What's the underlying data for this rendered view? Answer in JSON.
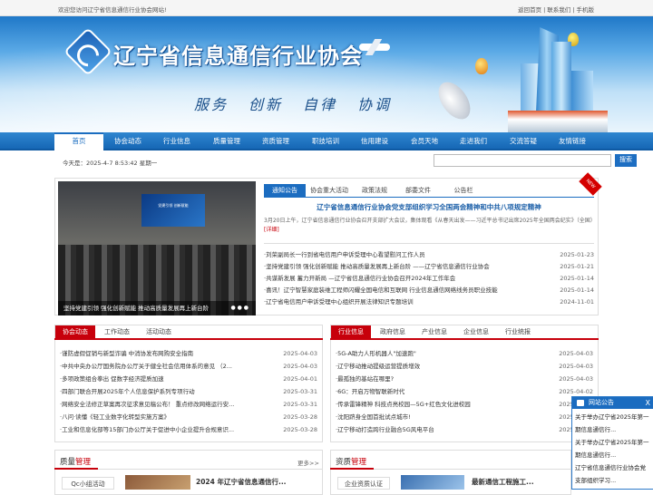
{
  "topbar": {
    "welcome": "欢迎您访问辽宁省信息通信行业协会网站!",
    "links": [
      "返回首页",
      "联系我们",
      "手机版"
    ],
    "separator": "|"
  },
  "banner": {
    "title": "辽宁省信息通信行业协会",
    "slogan": [
      "服务",
      "创新",
      "自律",
      "协调"
    ]
  },
  "nav": {
    "items": [
      "首页",
      "协会动态",
      "行业信息",
      "质量管理",
      "资质管理",
      "职技培训",
      "信用建设",
      "会员天地",
      "走进我们",
      "交流答疑",
      "友情链接"
    ]
  },
  "info": {
    "date": "今天是：2025-4-7 8:53:42 星期一",
    "search_placeholder": "",
    "search_label": "搜索"
  },
  "slide": {
    "caption": "坚持党建引领 强化创新赋能 推动高质量发展再上新台阶",
    "screen_text": "党建引领 创新赋能",
    "dots": "● ● ●"
  },
  "notice": {
    "tabs": [
      "通知公告",
      "协会重大活动",
      "政策法规",
      "部委文件",
      "公告栏"
    ],
    "ribbon": "NEW",
    "headline": "辽宁省信息通信行业协会党支部组织学习全国两会精神和中共八项规定精神",
    "summary": "3月20日上午，辽宁省信息通信行业协会召开支部扩大会议，集体观看《从春天出发——习近平总书记出席2025年全国两会纪实》（全国）",
    "summary_link": "[详细]",
    "items": [
      {
        "t": "·刘荣副局长一行到省电信用户申诉受理中心看望慰问工作人员",
        "d": "2025-01-23"
      },
      {
        "t": "·坚持党建引领 强化创新赋能 推动高质量发展再上新台阶 ——辽宁省信息通信行业协会",
        "d": "2025-01-21"
      },
      {
        "t": "·共谋新发展 蓄力开新局 —辽宁省信息通信行业协会召开2024年工作年会",
        "d": "2025-01-14"
      },
      {
        "t": "·喜讯！辽宁智慧家庭装维工程师闪耀全国电信和互联网 行业信息通信网络线务员职业技能",
        "d": "2025-01-14"
      },
      {
        "t": "·辽宁省电信用户申诉受理中心组织开展法律知识专题培训",
        "d": "2024-11-01"
      }
    ]
  },
  "assoc": {
    "tabs": [
      "协会动态",
      "工作动态",
      "活动动态"
    ],
    "items": [
      {
        "t": "·谨防虚假促销与新型诈骗 中消协发布网购安全指南",
        "d": "2025-04-03"
      },
      {
        "t": "·中共中央办公厅国务院办公厅关于健全社会信用体系的意见 （2...",
        "d": "2025-04-03"
      },
      {
        "t": "·多项政策组合拳出 促数字经济提质加速",
        "d": "2025-04-01"
      },
      {
        "t": "·四部门联合开展2025年个人信息保护系列专项行动",
        "d": "2025-03-31"
      },
      {
        "t": "·网络安全法修正草案再次征求意见稿公布！ 重点修改网络运行安...",
        "d": "2025-03-31"
      },
      {
        "t": "·八问·读懂《轻工业数字化转型实施方案》",
        "d": "2025-03-28"
      },
      {
        "t": "·工业和信息化部等15部门办公厅关于促进中小企业提升合规意识...",
        "d": "2025-03-28"
      }
    ]
  },
  "industry": {
    "tabs": [
      "行业信息",
      "政府信息",
      "产业信息",
      "企业信息",
      "行业统报"
    ],
    "items": [
      {
        "t": "·5G-A助力人形机器人\"加速跑\"",
        "d": "2025-04-03"
      },
      {
        "t": "·辽宁移动推动提级运营提质增效",
        "d": "2025-04-03"
      },
      {
        "t": "·最孤独的基站在哪里?",
        "d": "2025-04-03"
      },
      {
        "t": "·6G：开启万物智联新时代",
        "d": "2025-04-02"
      },
      {
        "t": "·传承雷锋精神 科技点亮校园—5G+红色文化进校园",
        "d": "2025-04-02"
      },
      {
        "t": "·沈阳跻身全国首批试点城市!",
        "d": "2025-04-01"
      },
      {
        "t": "·辽宁移动打造跨行业融合5G风电平台",
        "d": "2025-03-31"
      }
    ]
  },
  "quality": {
    "title_a": "质量",
    "title_b": "管理",
    "more": "更多>>",
    "subtab": "Qc小组活动",
    "headline": "2024 年辽宁省信息通信行..."
  },
  "qualification": {
    "title_a": "资质",
    "title_b": "管理",
    "subtab": "企业资质认证",
    "headline": "最新通信工程施工..."
  },
  "ad": {
    "title": "网站公告",
    "close": "X",
    "lines": [
      "关于举办辽宁省2025年第一期信息通信行...",
      "关于举办辽宁省2025年第一期信息通信行...",
      "辽宁省信息通信行业协会党支部组织学习..."
    ]
  }
}
